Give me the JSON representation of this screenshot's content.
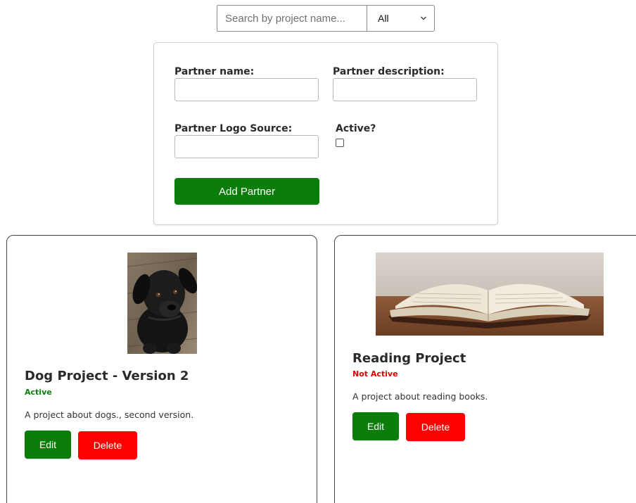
{
  "search": {
    "placeholder": "Search by project name...",
    "value": "",
    "filter_selected": "All",
    "filter_options": [
      "All"
    ]
  },
  "form": {
    "partner_name_label": "Partner name:",
    "partner_description_label": "Partner description:",
    "partner_logo_label": "Partner Logo Source:",
    "active_label": "Active?",
    "partner_name_value": "",
    "partner_description_value": "",
    "partner_logo_value": "",
    "active_checked": false,
    "submit_label": "Add Partner"
  },
  "projects": [
    {
      "title": "Dog Project - Version 2",
      "status": "Active",
      "description": "A project about dogs., second version.",
      "image": "black-puppy-photo",
      "edit_label": "Edit",
      "delete_label": "Delete"
    },
    {
      "title": "Reading Project",
      "status": "Not Active",
      "description": "A project about reading books.",
      "image": "open-book-photo",
      "edit_label": "Edit",
      "delete_label": "Delete"
    }
  ],
  "colors": {
    "primary_green": "#0b7d0b",
    "danger_red": "#ff0000",
    "active_text": "#0b7d0b",
    "inactive_text": "#e00000"
  }
}
